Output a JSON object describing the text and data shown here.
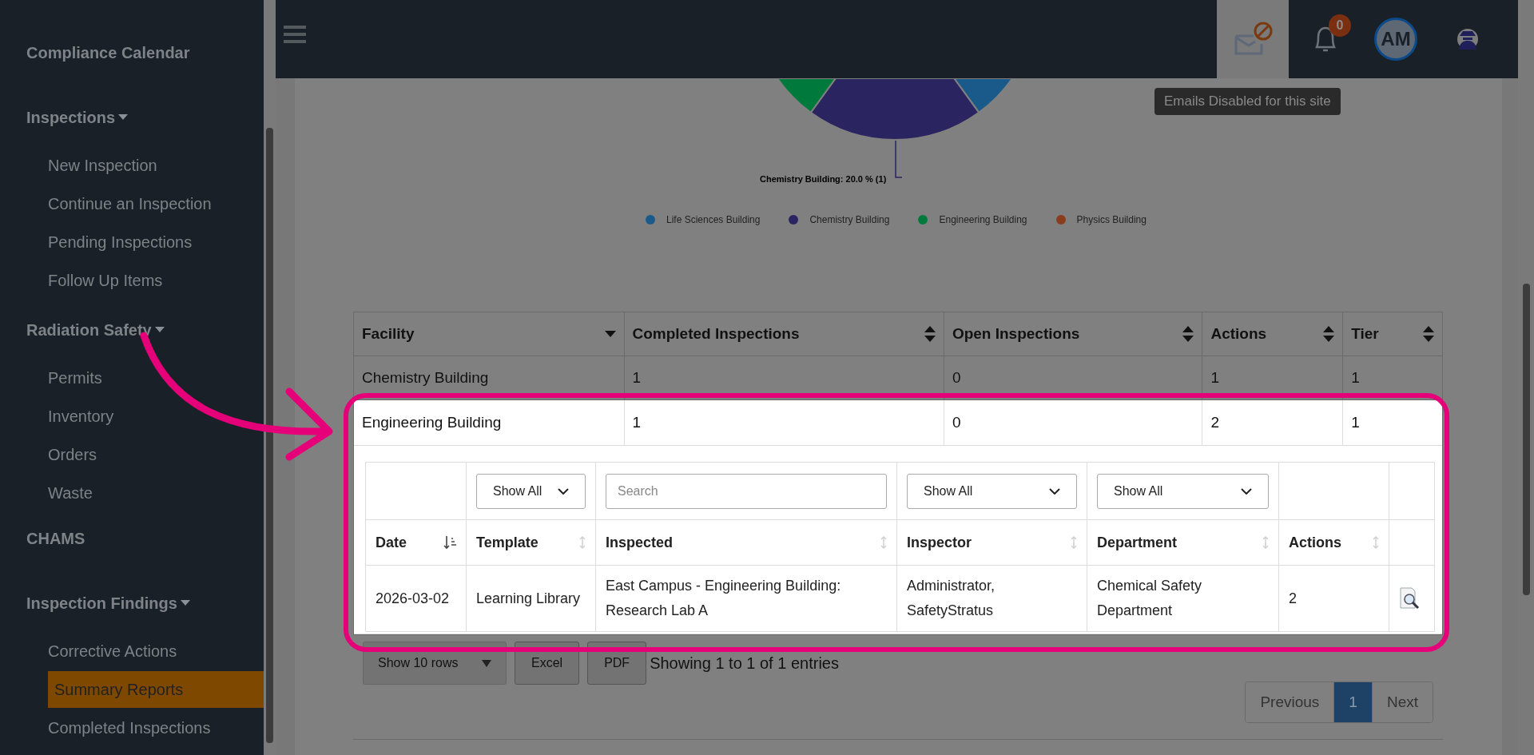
{
  "sidebar": {
    "items": [
      {
        "kind": "link",
        "label": "Compliance Calendar"
      },
      {
        "kind": "group",
        "label": "Inspections",
        "expanded": true,
        "children": [
          {
            "label": "New Inspection",
            "selected": false
          },
          {
            "label": "Continue an Inspection",
            "selected": false
          },
          {
            "label": "Pending Inspections",
            "selected": false
          },
          {
            "label": "Follow Up Items",
            "selected": false
          }
        ]
      },
      {
        "kind": "group",
        "label": "Radiation Safety",
        "expanded": true,
        "children": [
          {
            "label": "Permits",
            "selected": false
          },
          {
            "label": "Inventory",
            "selected": false
          },
          {
            "label": "Orders",
            "selected": false
          },
          {
            "label": "Waste",
            "selected": false
          }
        ]
      },
      {
        "kind": "link",
        "label": "CHAMS"
      },
      {
        "kind": "group",
        "label": "Inspection Findings",
        "expanded": true,
        "children": [
          {
            "label": "Corrective Actions",
            "selected": false
          },
          {
            "label": "Summary Reports",
            "selected": true
          },
          {
            "label": "Completed Inspections",
            "selected": false
          }
        ]
      }
    ]
  },
  "topbar": {
    "email_tooltip": "Emails Disabled for this site",
    "notification_count": "0",
    "avatar_initials": "AM"
  },
  "chart": {
    "callout": "Chemistry Building: 20.0 % (1)",
    "legend": [
      {
        "label": "Life Sciences Building",
        "color": "#1a5a8a"
      },
      {
        "label": "Chemistry Building",
        "color": "#2a2460"
      },
      {
        "label": "Engineering Building",
        "color": "#007a3c"
      },
      {
        "label": "Physics Building",
        "color": "#8a3c1e"
      }
    ]
  },
  "table": {
    "columns": [
      {
        "label": "Facility",
        "sorted": true
      },
      {
        "label": "Completed Inspections",
        "sorted": false
      },
      {
        "label": "Open Inspections",
        "sorted": false
      },
      {
        "label": "Actions",
        "sorted": false
      },
      {
        "label": "Tier",
        "sorted": false
      }
    ],
    "rows": [
      {
        "cells": [
          "Chemistry Building",
          "1",
          "0",
          "1",
          "1"
        ],
        "expanded": false
      },
      {
        "cells": [
          "Engineering Building",
          "1",
          "0",
          "2",
          "1"
        ],
        "expanded": true
      }
    ]
  },
  "detail": {
    "filters": [
      {
        "kind": "empty"
      },
      {
        "kind": "select",
        "value": "Show All"
      },
      {
        "kind": "search",
        "placeholder": "Search"
      },
      {
        "kind": "select",
        "value": "Show All"
      },
      {
        "kind": "select",
        "value": "Show All"
      },
      {
        "kind": "empty"
      },
      {
        "kind": "empty"
      }
    ],
    "columns": [
      {
        "label": "Date",
        "sorted": true
      },
      {
        "label": "Template",
        "sorted": false
      },
      {
        "label": "Inspected",
        "sorted": false
      },
      {
        "label": "Inspector",
        "sorted": false
      },
      {
        "label": "Department",
        "sorted": false
      },
      {
        "label": "Actions",
        "sorted": false
      },
      {}
    ],
    "rows": [
      {
        "cells": [
          "2026-03-02",
          "Learning Library",
          "East Campus - Engineering Building: Research Lab A",
          "Administrator, SafetyStratus",
          "Chemical Safety Department",
          "2"
        ]
      }
    ]
  },
  "footer": {
    "page_length": "Show 10 rows",
    "buttons": [
      "Excel",
      "PDF"
    ],
    "info": "Showing 1 to 1 of 1 entries",
    "pagination": [
      {
        "label": "Previous",
        "selected": false
      },
      {
        "label": "1",
        "selected": true
      },
      {
        "label": "Next",
        "selected": false
      }
    ]
  }
}
